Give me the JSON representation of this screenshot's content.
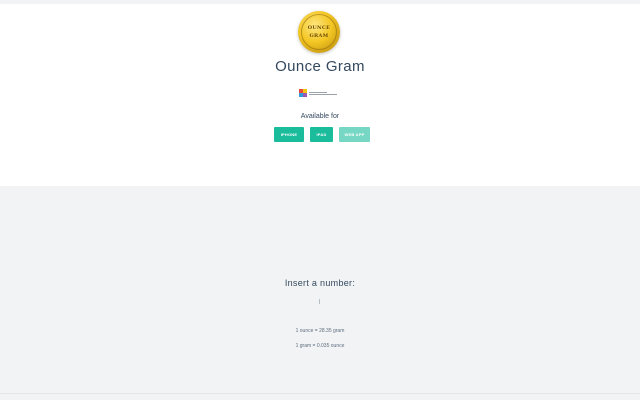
{
  "header": {
    "logo_text_line1": "OUNCE",
    "logo_text_line2": "GRAM",
    "title": "Ounce Gram",
    "available_label": "Available for",
    "platform_buttons": [
      {
        "label": "IPHONE",
        "disabled": false
      },
      {
        "label": "IPAD",
        "disabled": false
      },
      {
        "label": "WEB APP",
        "disabled": true
      }
    ]
  },
  "converter": {
    "insert_label": "Insert a number:",
    "input_value": "",
    "input_placeholder": "",
    "results": [
      "1 ounce = 28.35 gram",
      "1 gram = 0.035 ounce"
    ]
  },
  "colors": {
    "accent": "#1abc9c",
    "accent_disabled": "#76d7c4",
    "text": "#34495e",
    "background": "#f2f3f5"
  }
}
